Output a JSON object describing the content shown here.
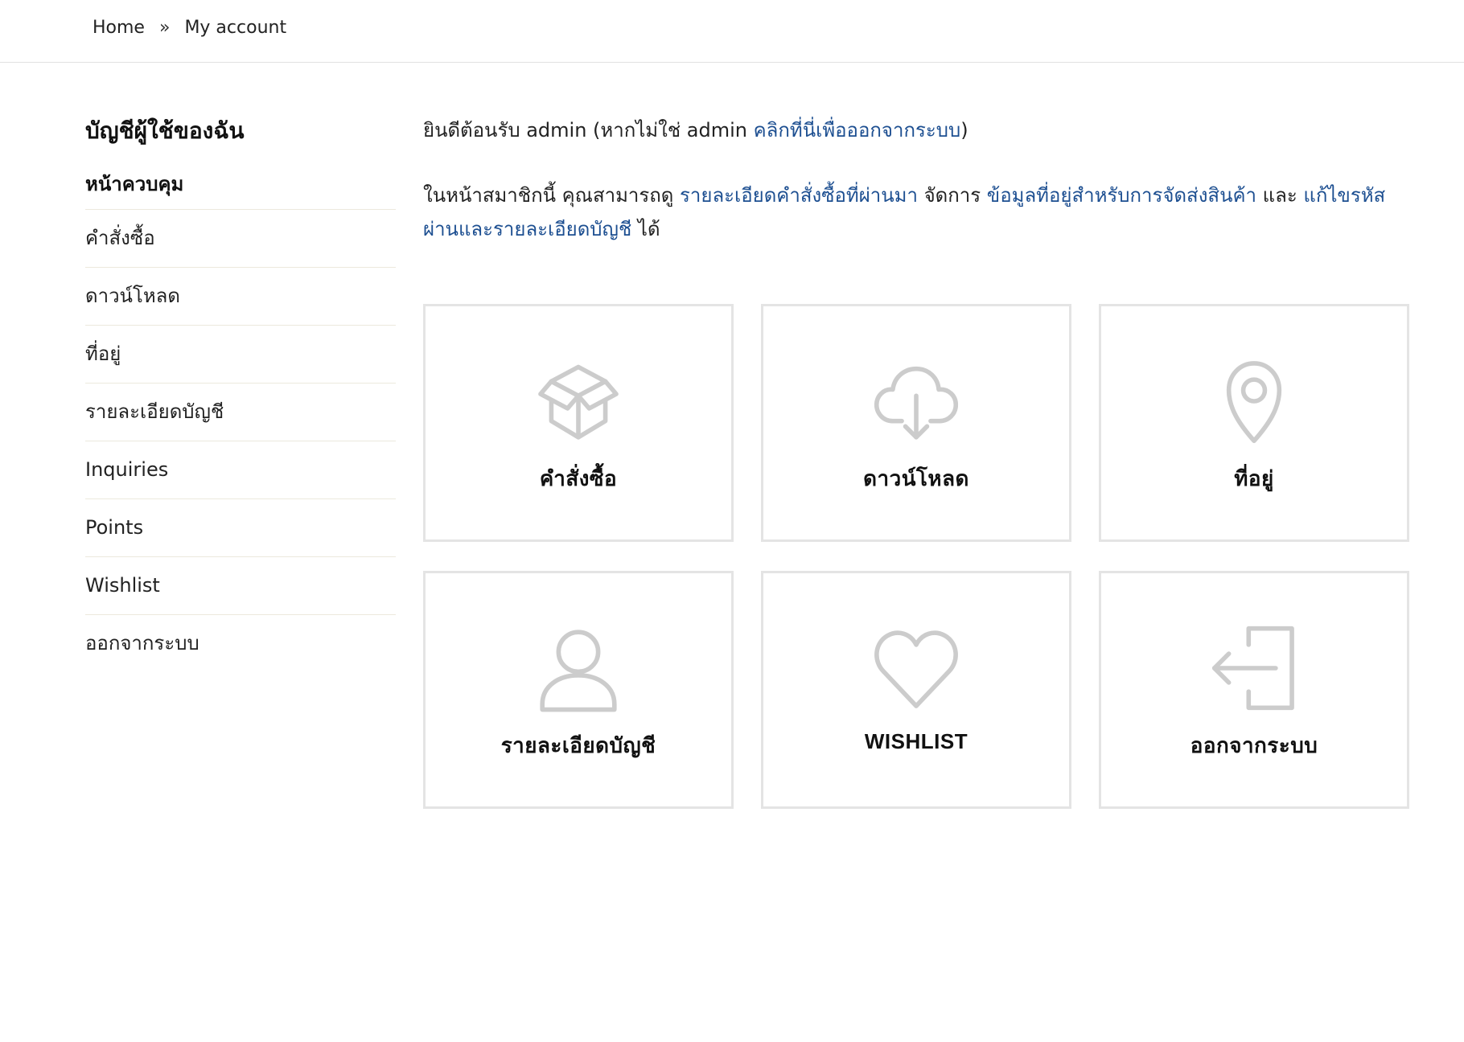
{
  "breadcrumb": {
    "home": "Home",
    "separator": "»",
    "current": "My account"
  },
  "sidebar": {
    "title": "บัญชีผู้ใช้ของฉัน",
    "items": [
      {
        "label": "หน้าควบคุม",
        "active": true
      },
      {
        "label": "คำสั่งซื้อ"
      },
      {
        "label": "ดาวน์โหลด"
      },
      {
        "label": "ที่อยู่"
      },
      {
        "label": "รายละเอียดบัญชี"
      },
      {
        "label": "Inquiries"
      },
      {
        "label": "Points"
      },
      {
        "label": "Wishlist"
      },
      {
        "label": "ออกจากระบบ"
      }
    ]
  },
  "welcome": {
    "prefix": "ยินดีต้อนรับ admin (หากไม่ใช่ admin ",
    "logout_link": "คลิกที่นี่เพื่อออกจากระบบ",
    "suffix": ")"
  },
  "intro": {
    "part1": "ในหน้าสมาชิกนี้ คุณสามารถดู ",
    "orders_link": "รายละเอียดคำสั่งซื้อที่ผ่านมา",
    "part2": " จัดการ ",
    "address_link": "ข้อมูลที่อยู่สำหรับการจัดส่งสินค้า",
    "part3": " และ ",
    "account_link": "แก้ไขรหัสผ่านและรายละเอียดบัญชี",
    "part4": " ได้"
  },
  "tiles": [
    {
      "label": "คำสั่งซื้อ",
      "icon": "box-icon"
    },
    {
      "label": "ดาวน์โหลด",
      "icon": "cloud-download-icon"
    },
    {
      "label": "ที่อยู่",
      "icon": "map-pin-icon"
    },
    {
      "label": "รายละเอียดบัญชี",
      "icon": "user-icon"
    },
    {
      "label": "WISHLIST",
      "icon": "heart-icon"
    },
    {
      "label": "ออกจากระบบ",
      "icon": "logout-icon"
    }
  ],
  "colors": {
    "link": "#1d4f91",
    "icon": "#cccccc",
    "tile_border": "#e4e4e4"
  }
}
